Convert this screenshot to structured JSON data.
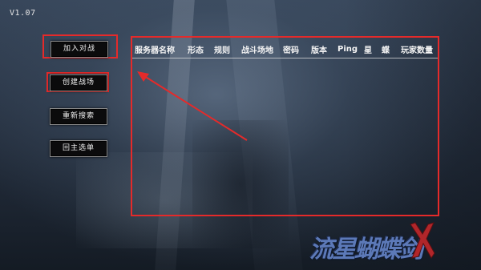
{
  "version": "V1.07",
  "menu": {
    "join_battle": "加入对战",
    "create_battle": "创建战场",
    "refresh_search": "重新搜索",
    "back_to_main": "回主选单"
  },
  "server_list": {
    "headers": [
      "服务器名称",
      "形态",
      "规则",
      "战斗场地",
      "密码",
      "版本",
      "Ping",
      "星",
      "蝶",
      "玩家数量"
    ],
    "rows": []
  },
  "logo": {
    "text": "流星蝴蝶剑"
  },
  "colors": {
    "annotation": "#e52a2a",
    "button_bg": "#0b0b0c"
  }
}
